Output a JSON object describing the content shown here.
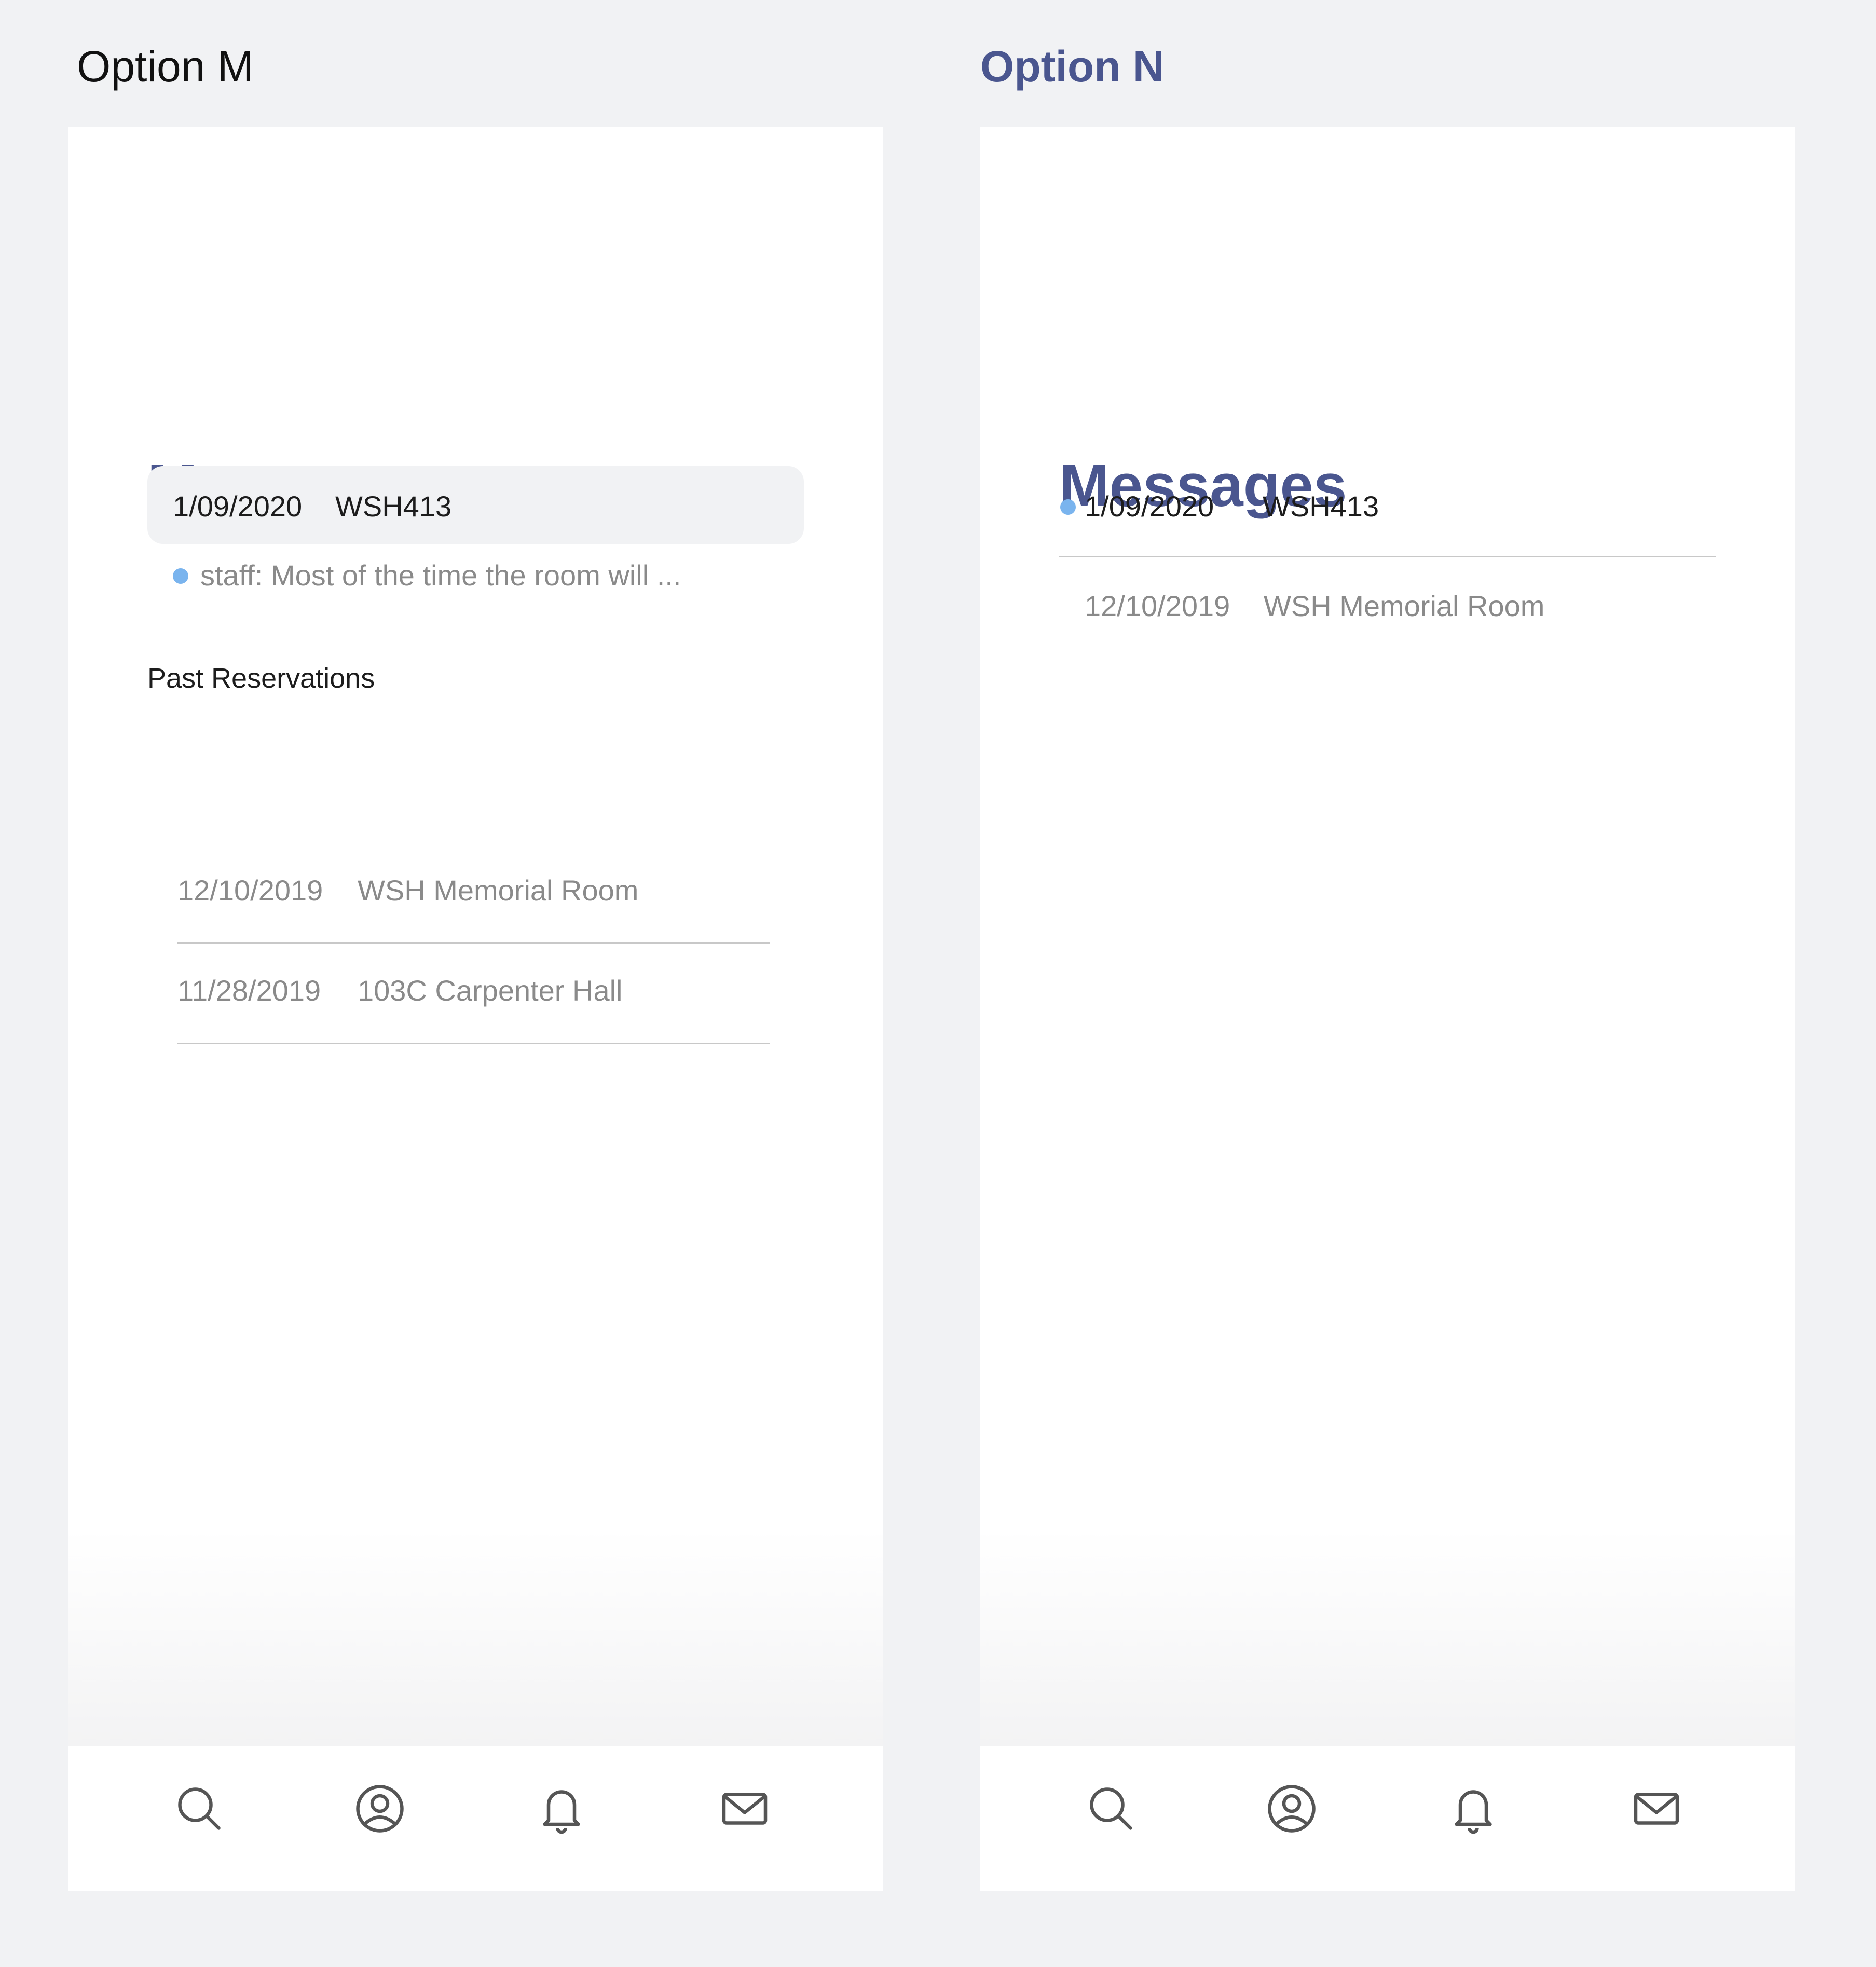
{
  "colors": {
    "accent": "#4a568f",
    "unread_dot": "#7ab4ee",
    "background": "#f1f2f4",
    "muted_text": "#8a8a8a"
  },
  "option_m": {
    "label": "Option M",
    "title": "Messages",
    "current": {
      "date": "1/09/2020",
      "code": "WSH413",
      "preview": "staff: Most of the time the room will ..."
    },
    "past_title": "Past Reservations",
    "past": [
      {
        "date": "12/10/2019",
        "location": "WSH Memorial Room"
      },
      {
        "date": "11/28/2019",
        "location": "103C Carpenter Hall"
      }
    ]
  },
  "option_n": {
    "label": "Option N",
    "title": "Messages",
    "current": {
      "date": "1/09/2020",
      "code": "WSH413"
    },
    "past": [
      {
        "date": "12/10/2019",
        "location": "WSH Memorial Room"
      }
    ]
  },
  "nav": {
    "icons": [
      "search-icon",
      "profile-icon",
      "bell-icon",
      "mail-icon"
    ]
  }
}
